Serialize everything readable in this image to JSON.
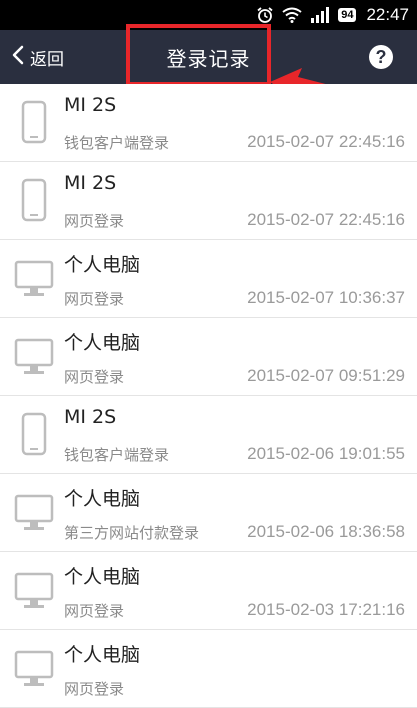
{
  "status_bar": {
    "battery": "94",
    "time": "22:47",
    "icons": [
      "alarm-icon",
      "wifi-icon",
      "signal-icon",
      "battery-icon"
    ]
  },
  "nav": {
    "back_label": "返回",
    "title": "登录记录",
    "help_label": "?",
    "icons": [
      "chevron-left-icon",
      "help-icon"
    ]
  },
  "colors": {
    "nav_background": "#2a2f3f",
    "annotation": "#e8262a"
  },
  "records": [
    {
      "device": "MI 2S",
      "device_type": "phone",
      "method": "钱包客户端登录",
      "time": "2015-02-07 22:45:16"
    },
    {
      "device": "MI 2S",
      "device_type": "phone",
      "method": "网页登录",
      "time": "2015-02-07 22:45:16"
    },
    {
      "device": "个人电脑",
      "device_type": "computer",
      "method": "网页登录",
      "time": "2015-02-07 10:36:37"
    },
    {
      "device": "个人电脑",
      "device_type": "computer",
      "method": "网页登录",
      "time": "2015-02-07 09:51:29"
    },
    {
      "device": "MI 2S",
      "device_type": "phone",
      "method": "钱包客户端登录",
      "time": "2015-02-06 19:01:55"
    },
    {
      "device": "个人电脑",
      "device_type": "computer",
      "method": "第三方网站付款登录",
      "time": "2015-02-06 18:36:58"
    },
    {
      "device": "个人电脑",
      "device_type": "computer",
      "method": "网页登录",
      "time": "2015-02-03 17:21:16"
    },
    {
      "device": "个人电脑",
      "device_type": "computer",
      "method": "网页登录",
      "time": ""
    }
  ]
}
